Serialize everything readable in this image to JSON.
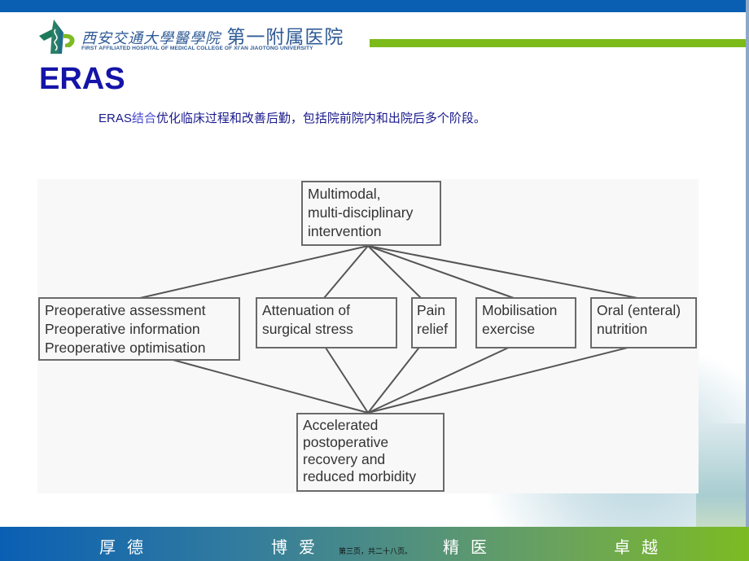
{
  "header": {
    "logo_icon": "hospital-emblem-icon",
    "institution_cn_script": "西安交通大學醫學院",
    "institution_cn_name": "第一附属医院",
    "institution_en": "FIRST AFFILIATED HOSPITAL OF MEDICAL COLLEGE OF XI'AN JIAOTONG UNIVERSITY",
    "colors": {
      "top_bar": "#0a5fb3",
      "accent_rule": "#7bbb1a",
      "title": "#1414a8"
    }
  },
  "slide": {
    "title": "ERAS",
    "subtitle_prefix": "ERAS",
    "subtitle_highlight": "结合",
    "subtitle_rest": "优化临床过程和改善后勤，包括院前院内和出院后多个阶段。"
  },
  "diagram": {
    "top_node": {
      "lines": [
        "Multimodal,",
        "multi-disciplinary",
        "intervention"
      ]
    },
    "middle_nodes": [
      {
        "id": "preop",
        "lines": [
          "Preoperative assessment",
          "Preoperative information",
          "Preoperative optimisation"
        ]
      },
      {
        "id": "stress",
        "lines": [
          "Attenuation of",
          "surgical stress"
        ]
      },
      {
        "id": "pain",
        "lines": [
          "Pain",
          "relief"
        ]
      },
      {
        "id": "mobil",
        "lines": [
          "Mobilisation",
          "exercise"
        ]
      },
      {
        "id": "oral",
        "lines": [
          "Oral (enteral)",
          "nutrition"
        ]
      }
    ],
    "bottom_node": {
      "lines": [
        "Accelerated",
        "postoperative",
        "recovery and",
        "reduced morbidity"
      ]
    }
  },
  "footer": {
    "mottos": [
      "厚德",
      "博爱",
      "精医",
      "卓越"
    ],
    "page_info": "第三页，共二十八页。"
  }
}
